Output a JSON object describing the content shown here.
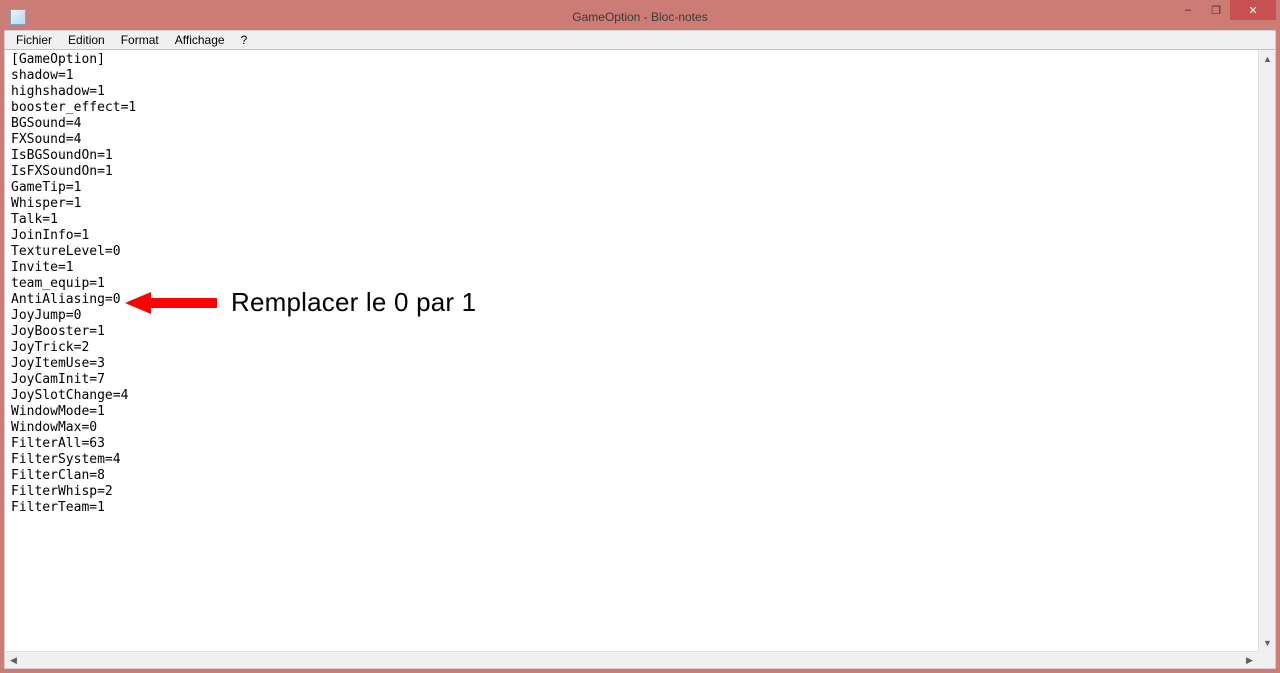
{
  "window": {
    "title": "GameOption - Bloc-notes"
  },
  "menubar": {
    "items": [
      "Fichier",
      "Edition",
      "Format",
      "Affichage",
      "?"
    ]
  },
  "editor": {
    "content": "[GameOption]\nshadow=1\nhighshadow=1\nbooster_effect=1\nBGSound=4\nFXSound=4\nIsBGSoundOn=1\nIsFXSoundOn=1\nGameTip=1\nWhisper=1\nTalk=1\nJoinInfo=1\nTextureLevel=0\nInvite=1\nteam_equip=1\nAntiAliasing=0\nJoyJump=0\nJoyBooster=1\nJoyTrick=2\nJoyItemUse=3\nJoyCamInit=7\nJoySlotChange=4\nWindowMode=1\nWindowMax=0\nFilterAll=63\nFilterSystem=4\nFilterClan=8\nFilterWhisp=2\nFilterTeam=1"
  },
  "annotation": {
    "text": "Remplacer le 0 par 1",
    "arrow_color": "#ff0000"
  },
  "win_controls": {
    "minimize": "–",
    "maximize": "❐",
    "close": "✕"
  }
}
